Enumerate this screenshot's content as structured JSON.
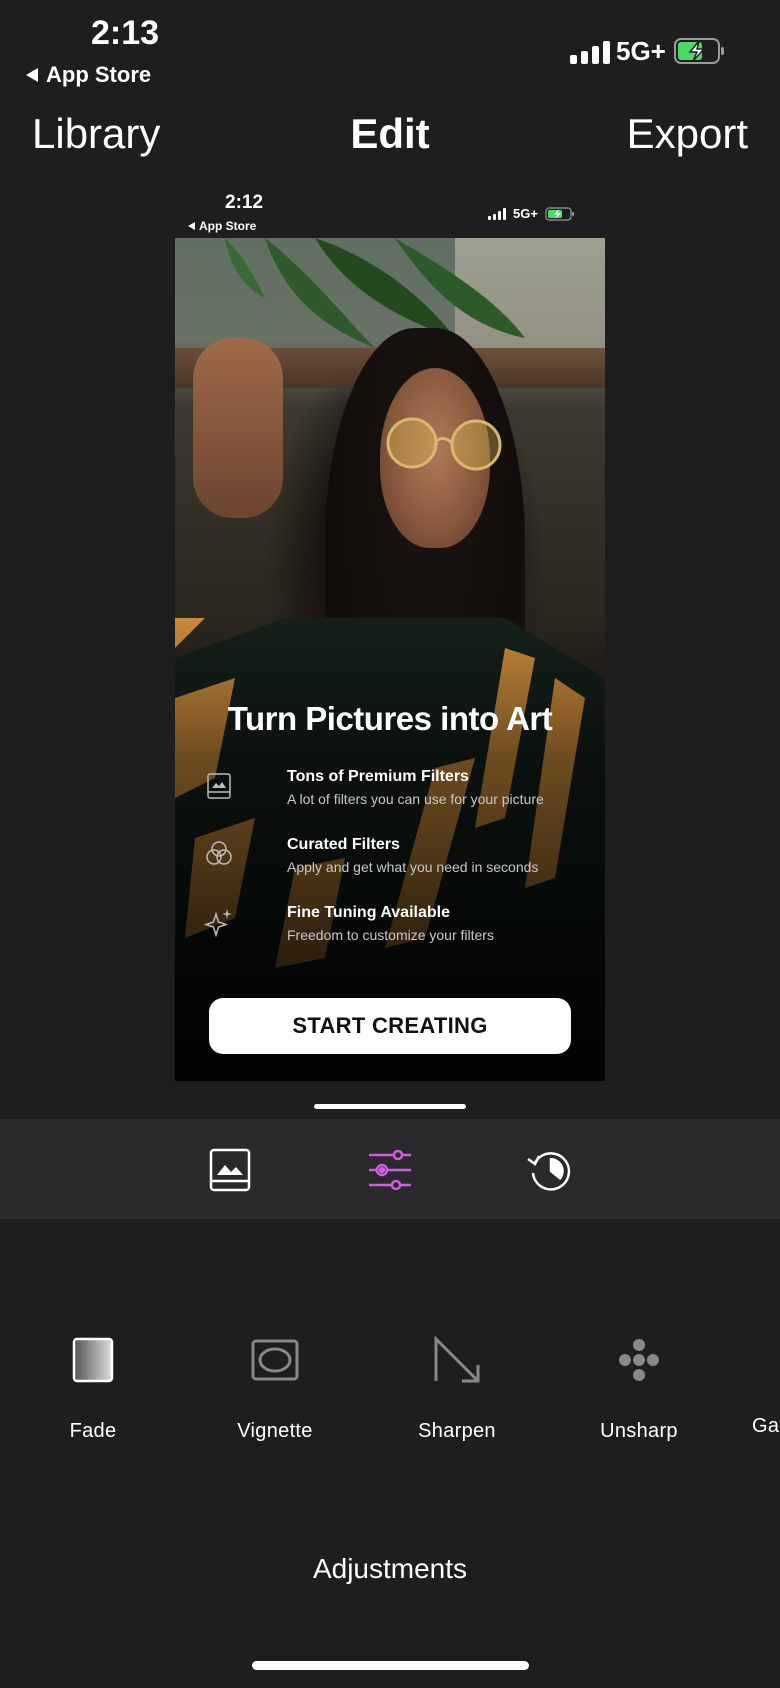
{
  "status_bar": {
    "time": "2:13",
    "back_label": "App Store",
    "network": "5G+",
    "signal_icon": "cellular-signal-icon",
    "battery_icon": "battery-charging-icon",
    "battery_color": "#4cd964"
  },
  "nav": {
    "left_label": "Library",
    "title": "Edit",
    "right_label": "Export"
  },
  "preview": {
    "status_bar": {
      "time": "2:12",
      "back_label": "App Store",
      "network": "5G+"
    },
    "headline": "Turn Pictures into Art",
    "features": [
      {
        "icon": "image-frame-icon",
        "title": "Tons of Premium Filters",
        "subtitle": "A lot of filters you can use for your picture"
      },
      {
        "icon": "overlapping-circles-icon",
        "title": "Curated Filters",
        "subtitle": "Apply and get what you need in seconds"
      },
      {
        "icon": "sparkle-icon",
        "title": "Fine Tuning Available",
        "subtitle": "Freedom to customize your filters"
      }
    ],
    "cta_label": "START CREATING"
  },
  "tool_tabs": [
    {
      "icon": "image-icon",
      "active": false
    },
    {
      "icon": "sliders-icon",
      "active": true
    },
    {
      "icon": "history-icon",
      "active": false
    }
  ],
  "accent_color": "#d15de0",
  "adjustments": [
    {
      "label": "Fade",
      "icon": "fade-gradient-icon"
    },
    {
      "label": "Vignette",
      "icon": "vignette-icon"
    },
    {
      "label": "Sharpen",
      "icon": "sharpen-arrow-icon"
    },
    {
      "label": "Unsharp",
      "icon": "unsharp-dots-icon"
    },
    {
      "label": "Ga",
      "icon": ""
    }
  ],
  "section_title": "Adjustments"
}
